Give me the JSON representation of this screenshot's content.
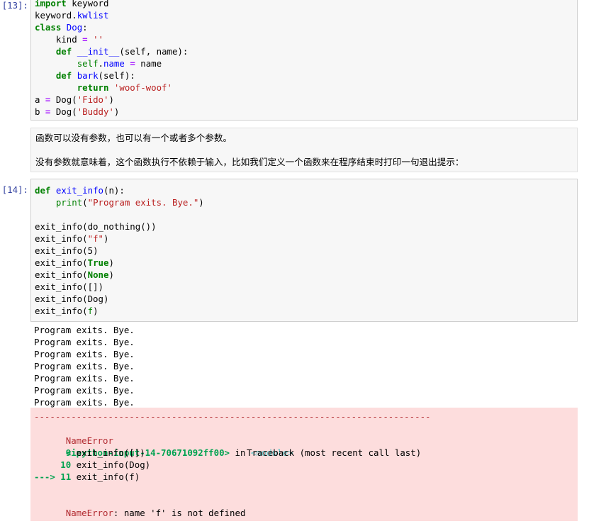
{
  "cell13": {
    "prompt": "[13]:",
    "lines": [
      [
        [
          "kw",
          "import"
        ],
        [
          "n",
          " keyword"
        ]
      ],
      [
        [
          "n",
          "keyword."
        ],
        [
          "var",
          "kwlist"
        ]
      ],
      [
        [
          "kw",
          "class"
        ],
        [
          "n",
          " "
        ],
        [
          "cls",
          "Dog"
        ],
        [
          "n",
          ":"
        ]
      ],
      [
        [
          "n",
          "    kind "
        ],
        [
          "op",
          "="
        ],
        [
          "n",
          " "
        ],
        [
          "str",
          "''"
        ]
      ],
      [
        [
          "n",
          "    "
        ],
        [
          "kw",
          "def"
        ],
        [
          "n",
          " "
        ],
        [
          "fn",
          "__init__"
        ],
        [
          "n",
          "(self, name):"
        ]
      ],
      [
        [
          "n",
          "        "
        ],
        [
          "bi",
          "self"
        ],
        [
          "n",
          "."
        ],
        [
          "var",
          "name"
        ],
        [
          "n",
          " "
        ],
        [
          "op",
          "="
        ],
        [
          "n",
          " name"
        ]
      ],
      [
        [
          "n",
          "    "
        ],
        [
          "kw",
          "def"
        ],
        [
          "n",
          " "
        ],
        [
          "fn",
          "bark"
        ],
        [
          "n",
          "(self):"
        ]
      ],
      [
        [
          "n",
          "        "
        ],
        [
          "kw",
          "return"
        ],
        [
          "n",
          " "
        ],
        [
          "str",
          "'woof-woof'"
        ]
      ],
      [
        [
          "n",
          "a "
        ],
        [
          "op",
          "="
        ],
        [
          "n",
          " Dog("
        ],
        [
          "str",
          "'Fido'"
        ],
        [
          "n",
          ")"
        ]
      ],
      [
        [
          "n",
          "b "
        ],
        [
          "op",
          "="
        ],
        [
          "n",
          " Dog("
        ],
        [
          "str",
          "'Buddy'"
        ],
        [
          "n",
          ")"
        ]
      ]
    ]
  },
  "markdown": {
    "para1": "函数可以没有参数，也可以有一个或者多个参数。",
    "para2": "没有参数就意味着，这个函数执行不依赖于输入，比如我们定义一个函数来在程序结束时打印一句退出提示："
  },
  "cell14": {
    "prompt": "[14]:",
    "lines": [
      [
        [
          "kw",
          "def"
        ],
        [
          "n",
          " "
        ],
        [
          "fn",
          "exit_info"
        ],
        [
          "n",
          "(n):"
        ]
      ],
      [
        [
          "n",
          "    "
        ],
        [
          "bi",
          "print"
        ],
        [
          "n",
          "("
        ],
        [
          "str",
          "\"Program exits. Bye.\""
        ],
        [
          "n",
          ")"
        ]
      ],
      [
        [
          "n",
          ""
        ]
      ],
      [
        [
          "n",
          "exit_info(do_nothing())"
        ]
      ],
      [
        [
          "n",
          "exit_info("
        ],
        [
          "str",
          "\"f\""
        ],
        [
          "n",
          ")"
        ]
      ],
      [
        [
          "n",
          "exit_info("
        ],
        [
          "n",
          "5"
        ],
        [
          "n",
          ")"
        ]
      ],
      [
        [
          "n",
          "exit_info("
        ],
        [
          "kw",
          "True"
        ],
        [
          "n",
          ")"
        ]
      ],
      [
        [
          "n",
          "exit_info("
        ],
        [
          "kw",
          "None"
        ],
        [
          "n",
          ")"
        ]
      ],
      [
        [
          "n",
          "exit_info([])"
        ]
      ],
      [
        [
          "n",
          "exit_info(Dog)"
        ]
      ],
      [
        [
          "n",
          "exit_info("
        ],
        [
          "bi",
          "f"
        ],
        [
          "n",
          ")"
        ]
      ]
    ],
    "stdout": [
      "Program exits. Bye.",
      "Program exits. Bye.",
      "Program exits. Bye.",
      "Program exits. Bye.",
      "Program exits. Bye.",
      "Program exits. Bye.",
      "Program exits. Bye."
    ],
    "traceback": {
      "dashes": "---------------------------------------------------------------------------",
      "error_name": "NameError",
      "traceback_label": "Traceback (most recent call last)",
      "input_ref": "<ipython-input-14-70671092ff00>",
      "in_word": " in ",
      "module": "<module>",
      "context_lines": [
        {
          "marker": "      ",
          "num": "9",
          "code": " exit_info([])"
        },
        {
          "marker": "     ",
          "num": "10",
          "code": " exit_info(Dog)"
        },
        {
          "marker": "---> ",
          "num": "11",
          "code": " exit_info(f)"
        }
      ],
      "final_name": "NameError",
      "final_msg": ": name 'f' is not defined"
    }
  }
}
